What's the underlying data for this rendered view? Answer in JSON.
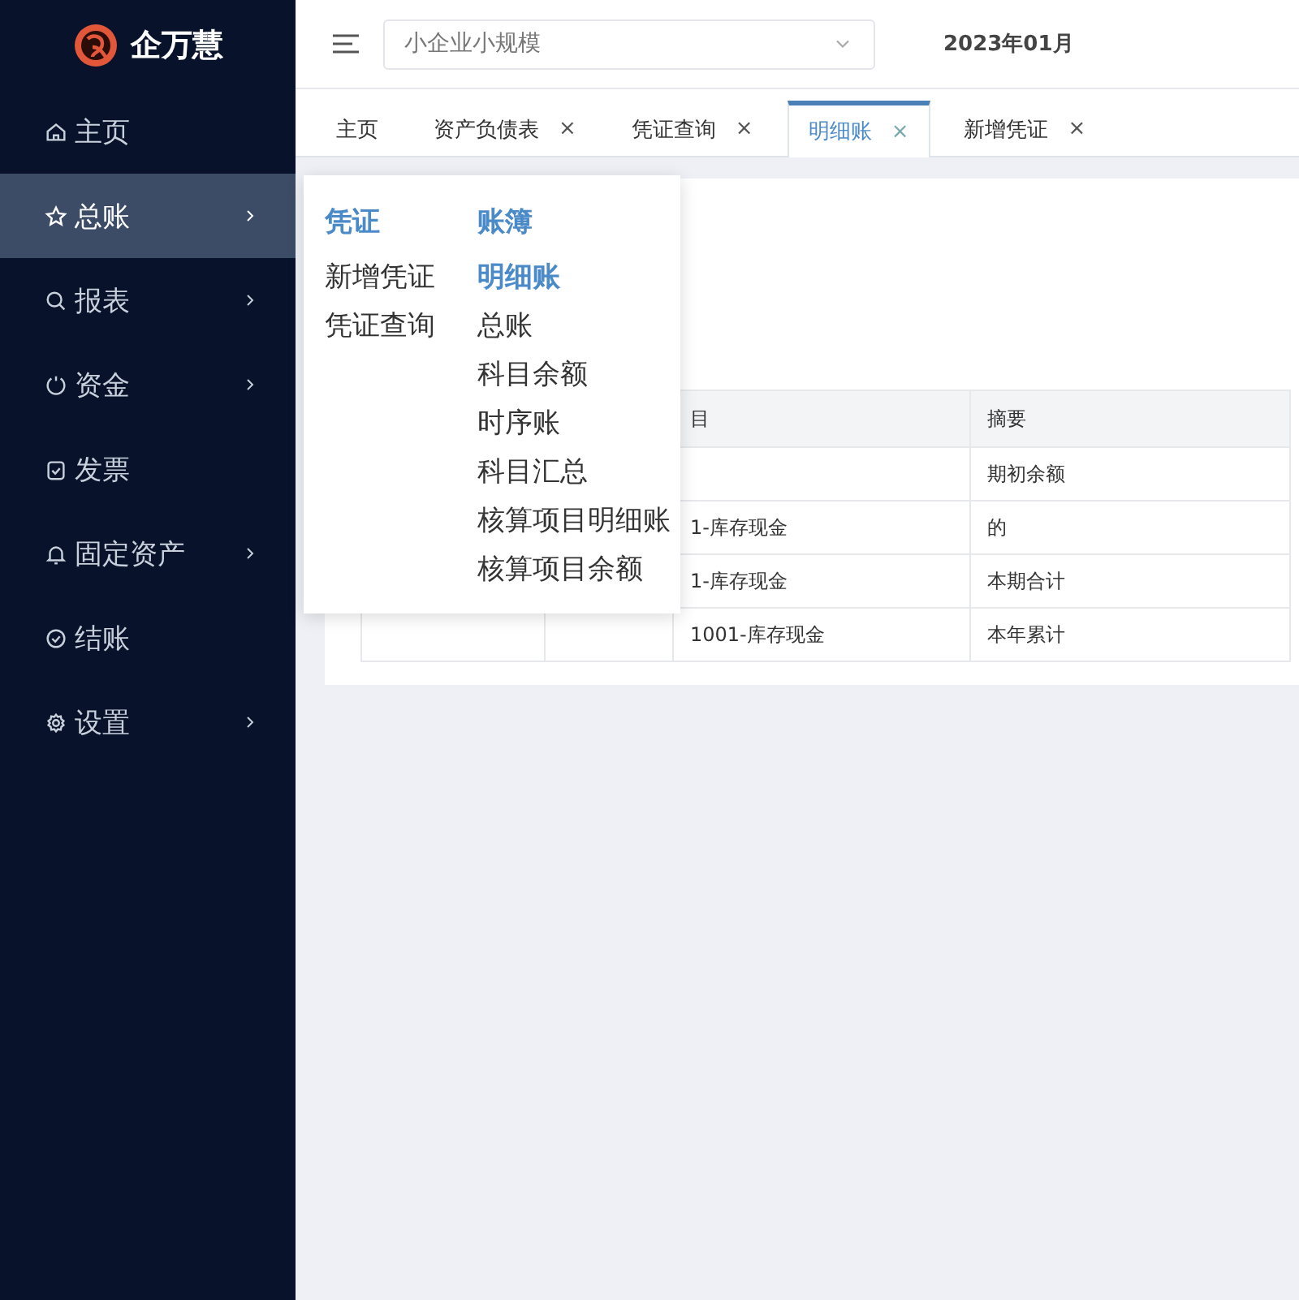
{
  "sidebar": {
    "logo_text": "企万慧",
    "items": [
      {
        "label": "主页",
        "selected": false,
        "has_submenu": false
      },
      {
        "label": "总账",
        "selected": true,
        "has_submenu": true
      },
      {
        "label": "报表",
        "selected": false,
        "has_submenu": true
      },
      {
        "label": "资金",
        "selected": false,
        "has_submenu": true
      },
      {
        "label": "发票",
        "selected": false,
        "has_submenu": false
      },
      {
        "label": "固定资产",
        "selected": false,
        "has_submenu": true
      },
      {
        "label": "结账",
        "selected": false,
        "has_submenu": false
      },
      {
        "label": "设置",
        "selected": false,
        "has_submenu": true
      }
    ]
  },
  "header": {
    "company_select": {
      "value": "小企业小规模"
    },
    "period": "2023年01月"
  },
  "tabs": [
    {
      "label": "主页",
      "selected": false,
      "closable": false
    },
    {
      "label": "资产负债表",
      "selected": false,
      "closable": true,
      "close": "×"
    },
    {
      "label": "凭证查询",
      "selected": false,
      "closable": true,
      "close": "×"
    },
    {
      "label": "明细账",
      "selected": true,
      "closable": true,
      "close": "×"
    },
    {
      "label": "新增凭证",
      "selected": false,
      "closable": true,
      "close": "×"
    }
  ],
  "table": {
    "columns": [
      "目",
      "摘要"
    ],
    "rows": [
      {
        "column_4": "期初余额"
      },
      {
        "column_3": "1-库存现金",
        "column_4": "的"
      },
      {
        "column_3": "1-库存现金",
        "column_4": "本期合计"
      },
      {
        "column_3": "1001-库存现金",
        "column_4": "本年累计"
      }
    ]
  },
  "menu": {
    "groups": [
      {
        "title": "凭证",
        "items": [
          {
            "label": "新增凭证",
            "selected": false
          },
          {
            "label": "凭证查询",
            "selected": false
          }
        ]
      },
      {
        "title": "账簿",
        "items": [
          {
            "label": "明细账",
            "selected": true
          },
          {
            "label": "总账",
            "selected": false
          },
          {
            "label": "科目余额",
            "selected": false
          },
          {
            "label": "时序账",
            "selected": false
          },
          {
            "label": "科目汇总",
            "selected": false
          },
          {
            "label": "核算项目明细账",
            "selected": false
          },
          {
            "label": "核算项目余额",
            "selected": false
          }
        ]
      }
    ]
  }
}
